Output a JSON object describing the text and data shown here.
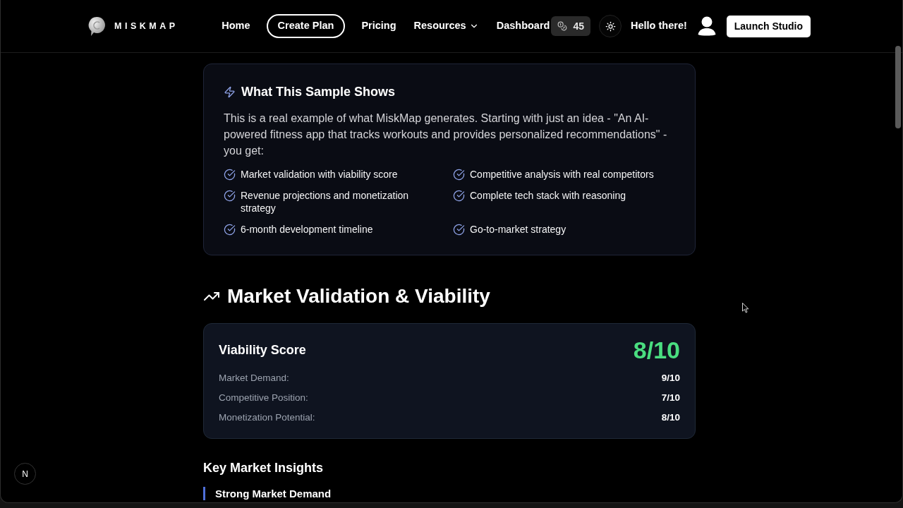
{
  "header": {
    "logo": "MISKMAP",
    "nav": [
      {
        "label": "Home",
        "kind": "link",
        "selected": false
      },
      {
        "label": "Create Plan",
        "kind": "link",
        "selected": true
      },
      {
        "label": "Pricing",
        "kind": "link",
        "selected": false
      },
      {
        "label": "Resources",
        "kind": "dropdown",
        "selected": false
      },
      {
        "label": "Dashboard",
        "kind": "link",
        "selected": false
      }
    ],
    "credits": "45",
    "greeting": "Hello there!",
    "cta": "Launch Studio"
  },
  "sample_card": {
    "title": "What This Sample Shows",
    "description": "This is a real example of what MiskMap generates. Starting with just an idea - \"An AI-powered fitness app that tracks workouts and provides personalized recommendations\" - you get:",
    "features": [
      "Market validation with viability score",
      "Competitive analysis with real competitors",
      "Revenue projections and monetization strategy",
      "Complete tech stack with reasoning",
      "6-month development timeline",
      "Go-to-market strategy"
    ]
  },
  "market_section": {
    "title": "Market Validation & Viability",
    "viability_card": {
      "title": "Viability Score",
      "score": "8/10",
      "metrics": [
        {
          "label": "Market Demand:",
          "value": "9/10"
        },
        {
          "label": "Competitive Position:",
          "value": "7/10"
        },
        {
          "label": "Monetization Potential:",
          "value": "8/10"
        }
      ]
    }
  },
  "insights": {
    "title": "Key Market Insights",
    "items": [
      {
        "title": "Strong Market Demand"
      }
    ]
  },
  "dev_indicator": {
    "label": "N"
  }
}
